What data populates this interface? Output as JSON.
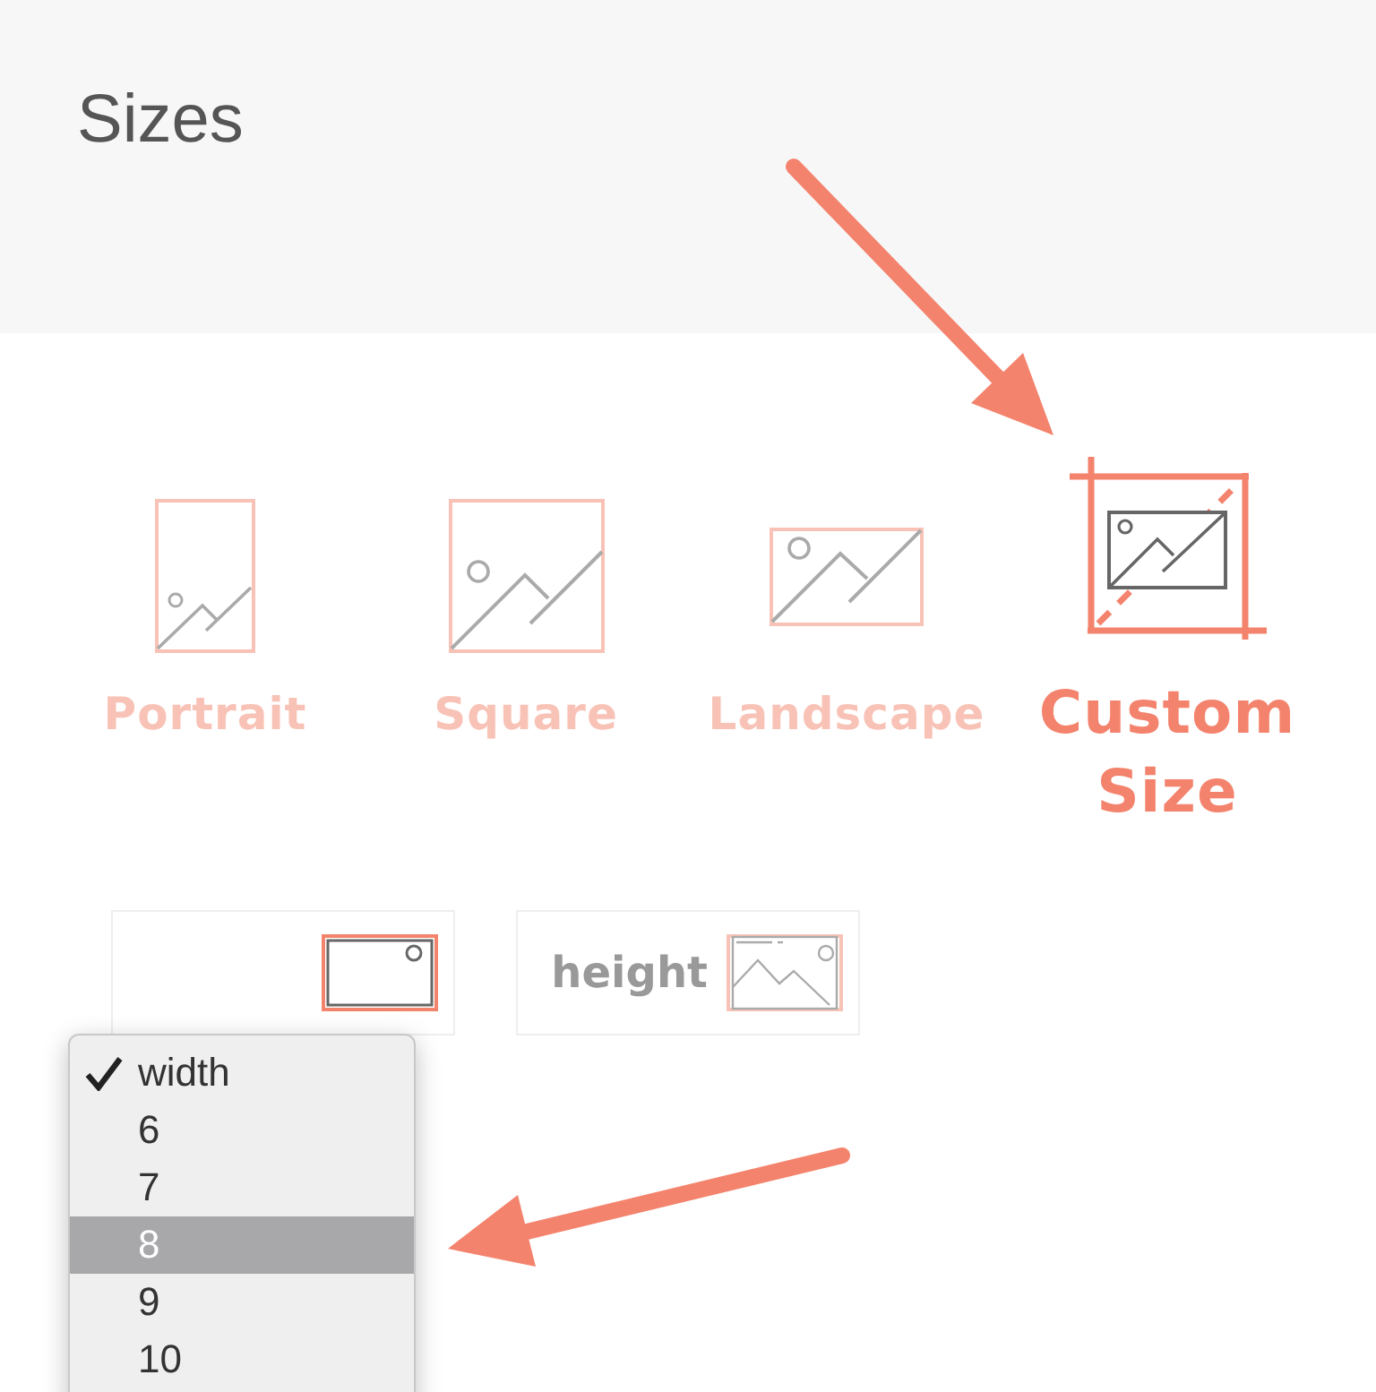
{
  "header": {
    "title": "Sizes"
  },
  "sizes": [
    {
      "kind": "portrait",
      "label": "Portrait",
      "selected": false
    },
    {
      "kind": "square",
      "label": "Square",
      "selected": false
    },
    {
      "kind": "landscape",
      "label": "Landscape",
      "selected": false
    },
    {
      "kind": "custom",
      "label": "Custom Size",
      "selected": true
    }
  ],
  "dimension_fields": [
    {
      "kind": "width",
      "selected": true
    },
    {
      "kind": "height",
      "label": "height",
      "selected": false
    }
  ],
  "dropdown_menu": [
    {
      "label": "width",
      "checked": true,
      "selected": false
    },
    {
      "label": "6",
      "checked": false,
      "selected": false
    },
    {
      "label": "7",
      "checked": false,
      "selected": false
    },
    {
      "label": "8",
      "checked": false,
      "selected": true
    },
    {
      "label": "9",
      "checked": false,
      "selected": false
    },
    {
      "label": "10",
      "checked": false,
      "selected": false
    }
  ]
}
